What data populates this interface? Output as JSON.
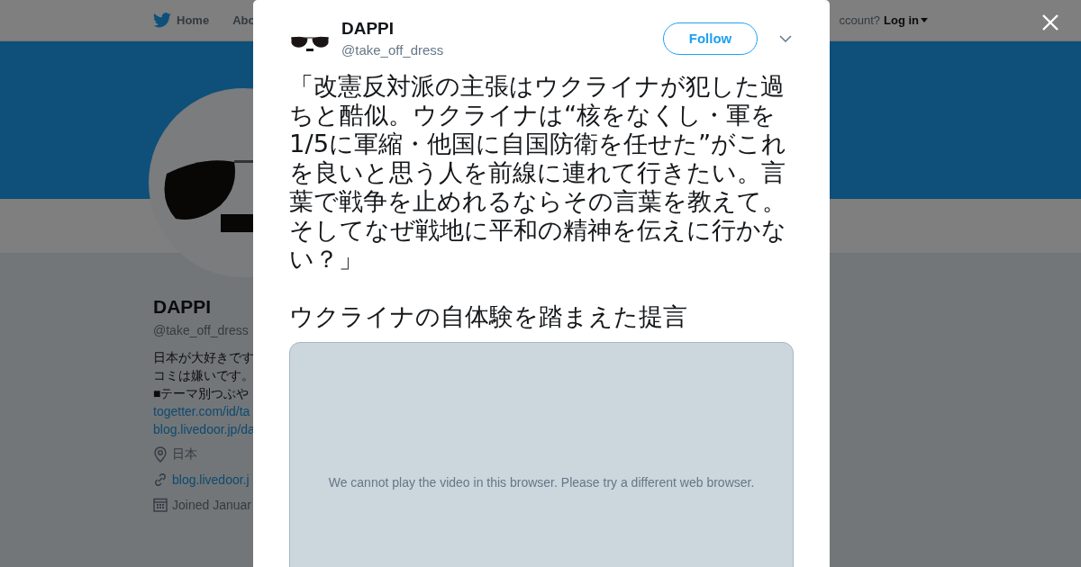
{
  "top_nav": {
    "items": [
      {
        "label": "Home"
      },
      {
        "label": "Abo"
      }
    ],
    "account_prompt": "ccount?",
    "login": "Log in"
  },
  "profile": {
    "name": "DAPPI",
    "handle": "@take_off_dress",
    "bio": [
      "日本が大好きです",
      "コミは嫌いです。",
      "■テーマ別つぶや"
    ],
    "bio_links": [
      "togetter.com/id/ta",
      "blog.livedoor.jp/da"
    ],
    "location": "日本",
    "website": "blog.livedoor.j",
    "joined": "Joined Januar"
  },
  "tweet_modal": {
    "author": "DAPPI",
    "handle": "@take_off_dress",
    "follow": "Follow",
    "text": "「改憲反対派の主張はウクライナが犯した過ちと酷似。ウクライナは“核をなくし・軍を1/5に軍縮・他国に自国防衛を任せた”がこれを良いと思う人を前線に連れて行きたい。言葉で戦争を止めれるならその言葉を教えて。そしてなぜ戦地に平和の精神を伝えに行かない？」",
    "video_title": "ウクライナの自体験を踏まえた提言",
    "video_message": "We cannot play the video in this browser. Please try a different web browser."
  }
}
